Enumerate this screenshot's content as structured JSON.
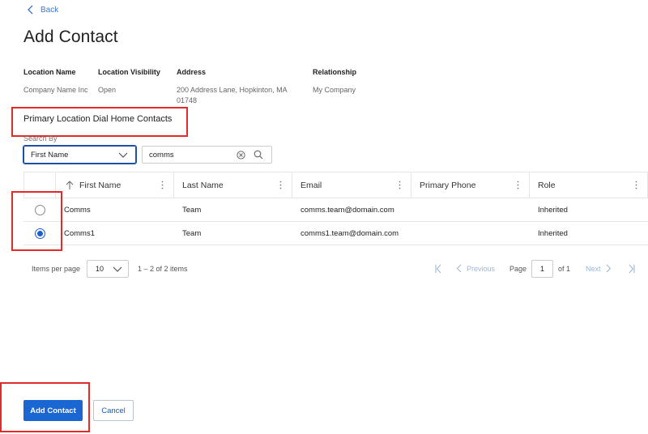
{
  "nav": {
    "back_label": "Back"
  },
  "page": {
    "title": "Add Contact"
  },
  "location": {
    "name_label": "Location Name",
    "name_value": "Company Name Inc",
    "visibility_label": "Location Visibility",
    "visibility_value": "Open",
    "address_label": "Address",
    "address_value": "200 Address Lane, Hopkinton, MA 01748",
    "relationship_label": "Relationship",
    "relationship_value": "My Company"
  },
  "section": {
    "title": "Primary Location Dial Home Contacts"
  },
  "search": {
    "label": "Search By",
    "field_value": "First Name",
    "query": "comms"
  },
  "table": {
    "columns": [
      "First Name",
      "Last Name",
      "Email",
      "Primary Phone",
      "Role"
    ],
    "sort_column": "First Name",
    "sort_direction": "ascending",
    "rows": [
      {
        "selected": false,
        "first": "Comms",
        "last": "Team",
        "email": "comms.team@domain.com",
        "phone": "",
        "role": "Inherited"
      },
      {
        "selected": true,
        "first": "Comms1",
        "last": "Team",
        "email": "comms1.team@domain.com",
        "phone": "",
        "role": "Inherited"
      }
    ]
  },
  "pager": {
    "items_per_page_label": "Items per page",
    "items_per_page": "10",
    "range": "1 – 2 of 2 items",
    "previous_label": "Previous",
    "page_label": "Page",
    "page": "1",
    "of_label": "of 1",
    "next_label": "Next"
  },
  "actions": {
    "add_label": "Add Contact",
    "cancel_label": "Cancel"
  },
  "colors": {
    "primary": "#1a66d2",
    "link": "#3a78c9",
    "highlight": "#e02b2b"
  }
}
